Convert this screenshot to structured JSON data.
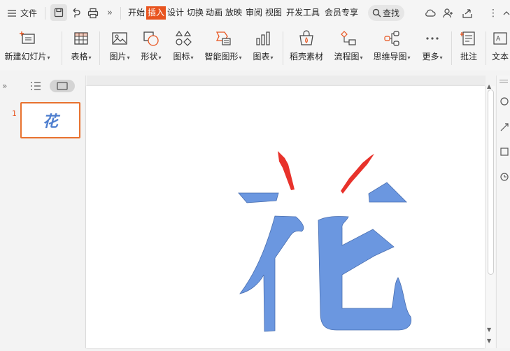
{
  "menu": {
    "file_label": "文件"
  },
  "tabs": [
    "开始",
    "插入",
    "设计",
    "切换",
    "动画",
    "放映",
    "审阅",
    "视图",
    "开发工具",
    "会员专享"
  ],
  "active_tab_index": 1,
  "search": {
    "label": "查找"
  },
  "ribbon": {
    "new_slide": "新建幻灯片",
    "table": "表格",
    "picture": "图片",
    "shape": "形状",
    "icon": "图标",
    "smart_art": "智能图形",
    "chart": "图表",
    "docer_material": "稻壳素材",
    "flowchart": "流程图",
    "mind_map": "思维导图",
    "more": "更多",
    "comment": "批注",
    "textbox": "文本"
  },
  "slides_panel": {
    "current_slide_number": "1",
    "thumb_text": "花"
  },
  "colors": {
    "accent": "#e8541f",
    "glyph": "#6b97e0",
    "arrow": "#e8322b"
  }
}
